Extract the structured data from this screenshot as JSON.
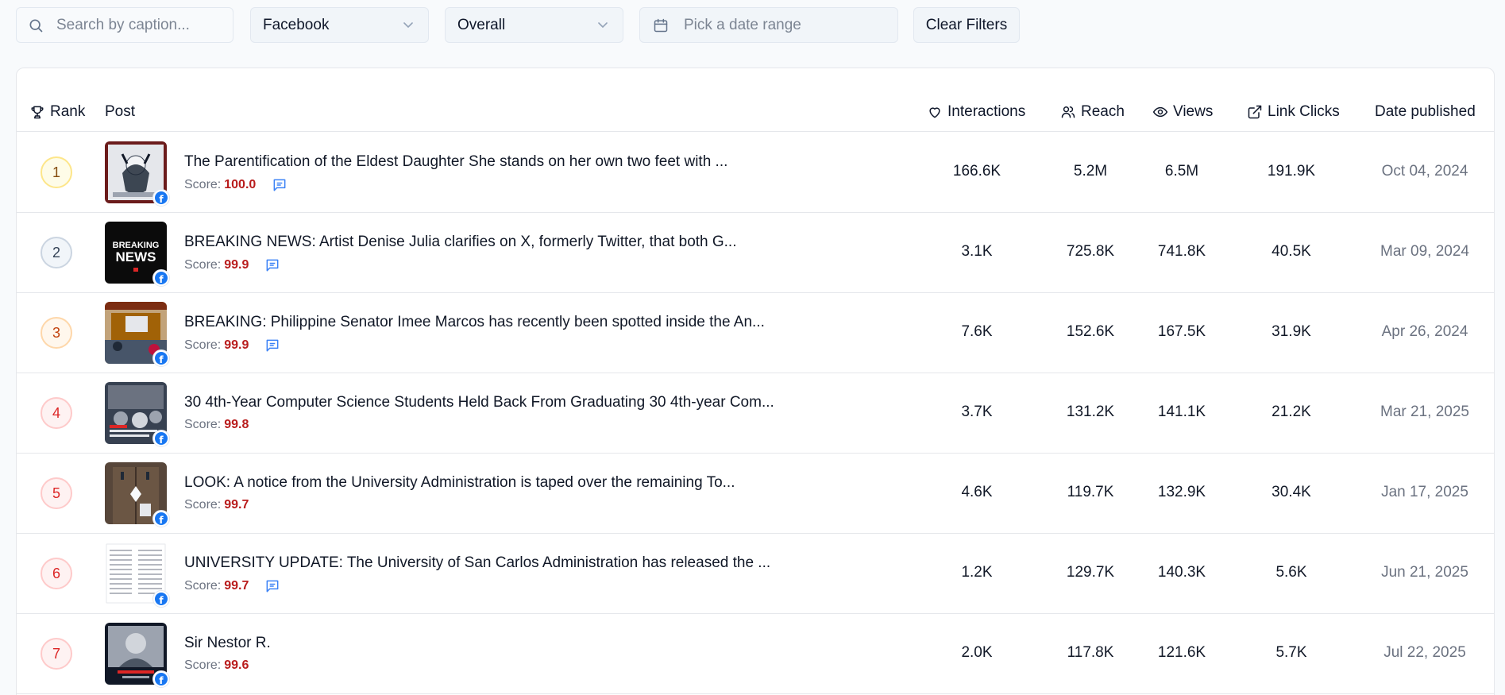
{
  "filters": {
    "search_placeholder": "Search by caption...",
    "platform": "Facebook",
    "period": "Overall",
    "date_placeholder": "Pick a date range",
    "clear_label": "Clear Filters"
  },
  "table": {
    "headers": {
      "rank": "Rank",
      "post": "Post",
      "interactions": "Interactions",
      "reach": "Reach",
      "views": "Views",
      "link_clicks": "Link Clicks",
      "date": "Date published"
    },
    "score_label": "Score:",
    "rows": [
      {
        "rank": "1",
        "caption": "The Parentification of the Eldest Daughter She stands on her own two feet with ...",
        "score": "100.0",
        "has_comments": true,
        "interactions": "166.6K",
        "reach": "5.2M",
        "views": "6.5M",
        "link_clicks": "191.9K",
        "date": "Oct 04, 2024"
      },
      {
        "rank": "2",
        "caption": "BREAKING NEWS: Artist Denise Julia clarifies on X, formerly Twitter, that both G...",
        "score": "99.9",
        "has_comments": true,
        "interactions": "3.1K",
        "reach": "725.8K",
        "views": "741.8K",
        "link_clicks": "40.5K",
        "date": "Mar 09, 2024",
        "thumb_text": [
          "BREAKING",
          "NEWS"
        ]
      },
      {
        "rank": "3",
        "caption": "BREAKING: Philippine Senator Imee Marcos has recently been spotted inside the An...",
        "score": "99.9",
        "has_comments": true,
        "interactions": "7.6K",
        "reach": "152.6K",
        "views": "167.5K",
        "link_clicks": "31.9K",
        "date": "Apr 26, 2024"
      },
      {
        "rank": "4",
        "caption": "30 4th-Year Computer Science Students Held Back From Graduating 30 4th-year Com...",
        "score": "99.8",
        "has_comments": false,
        "interactions": "3.7K",
        "reach": "131.2K",
        "views": "141.1K",
        "link_clicks": "21.2K",
        "date": "Mar 21, 2025"
      },
      {
        "rank": "5",
        "caption": "LOOK: A notice from the University Administration is taped over the remaining To...",
        "score": "99.7",
        "has_comments": false,
        "interactions": "4.6K",
        "reach": "119.7K",
        "views": "132.9K",
        "link_clicks": "30.4K",
        "date": "Jan 17, 2025"
      },
      {
        "rank": "6",
        "caption": "UNIVERSITY UPDATE: The University of San Carlos Administration has released the ...",
        "score": "99.7",
        "has_comments": true,
        "interactions": "1.2K",
        "reach": "129.7K",
        "views": "140.3K",
        "link_clicks": "5.6K",
        "date": "Jun 21, 2025"
      },
      {
        "rank": "7",
        "caption": "Sir Nestor R.",
        "score": "99.6",
        "has_comments": false,
        "interactions": "2.0K",
        "reach": "117.8K",
        "views": "121.6K",
        "link_clicks": "5.7K",
        "date": "Jul 22, 2025"
      }
    ]
  },
  "colors": {
    "score": "#b91c1c",
    "facebook": "#1877f2",
    "comment_icon": "#3b82f6"
  }
}
